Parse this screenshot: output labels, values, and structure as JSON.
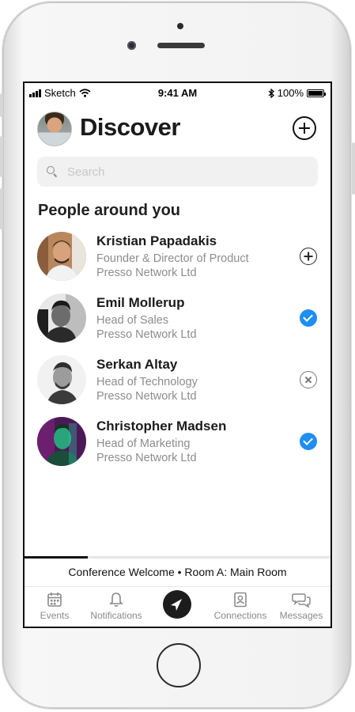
{
  "status_bar": {
    "carrier": "Sketch",
    "time": "9:41 AM",
    "battery": "100%"
  },
  "header": {
    "title": "Discover"
  },
  "search": {
    "placeholder": "Search"
  },
  "section": {
    "title": "People around you"
  },
  "people": [
    {
      "name": "Kristian Papadakis",
      "role": "Founder & Director of Product",
      "company": "Presso Network Ltd",
      "status": "add"
    },
    {
      "name": "Emil Mollerup",
      "role": "Head of Sales",
      "company": "Presso Network Ltd",
      "status": "connected"
    },
    {
      "name": "Serkan Altay",
      "role": "Head of Technology",
      "company": "Presso Network Ltd",
      "status": "removed"
    },
    {
      "name": "Christopher Madsen",
      "role": "Head of Marketing",
      "company": "Presso Network Ltd",
      "status": "connected"
    }
  ],
  "now_playing": {
    "text": "Conference Welcome • Room A: Main Room"
  },
  "tabbar": {
    "events": "Events",
    "notifications": "Notifications",
    "connections": "Connections",
    "messages": "Messages"
  },
  "colors": {
    "accent": "#1e8ef2",
    "secondary_text": "#8d8d8d"
  }
}
